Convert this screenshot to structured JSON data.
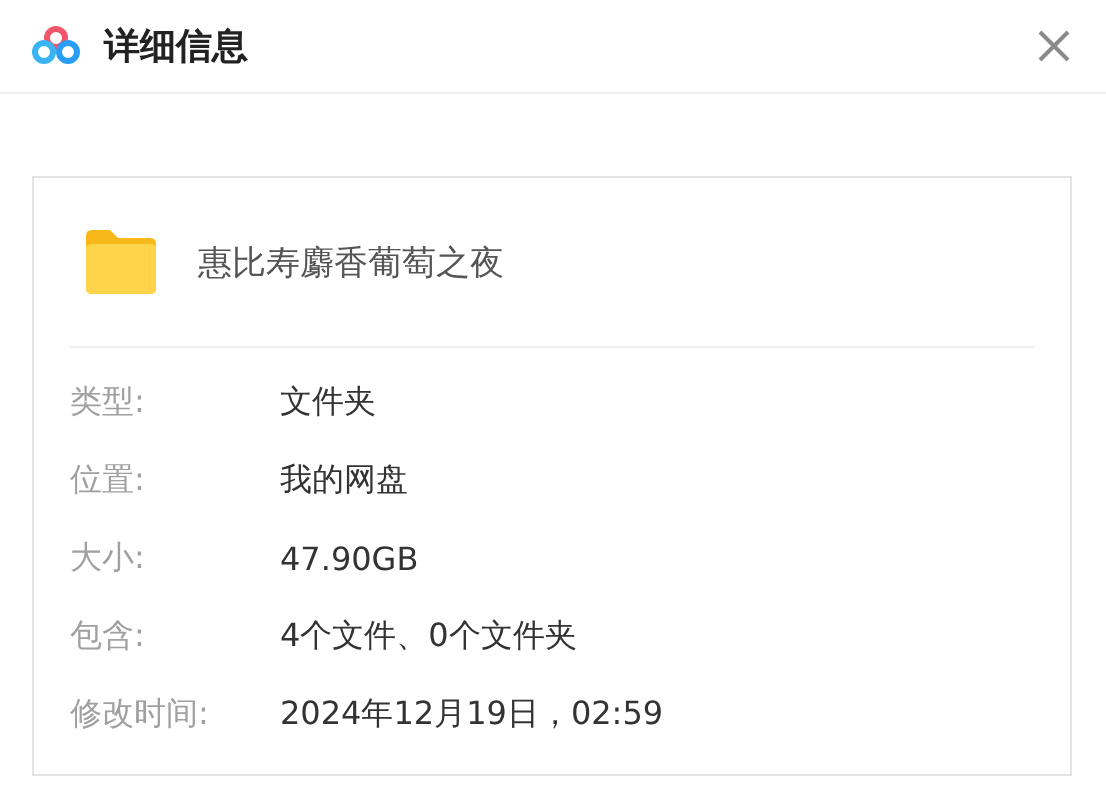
{
  "window": {
    "title": "详细信息"
  },
  "file": {
    "name": "惠比寿麝香葡萄之夜"
  },
  "properties": [
    {
      "label": "类型:",
      "value": "文件夹"
    },
    {
      "label": "位置:",
      "value": "我的网盘"
    },
    {
      "label": "大小:",
      "value": "47.90GB"
    },
    {
      "label": "包含:",
      "value": "4个文件、0个文件夹"
    },
    {
      "label": "修改时间:",
      "value": "2024年12月19日，02:59"
    }
  ]
}
